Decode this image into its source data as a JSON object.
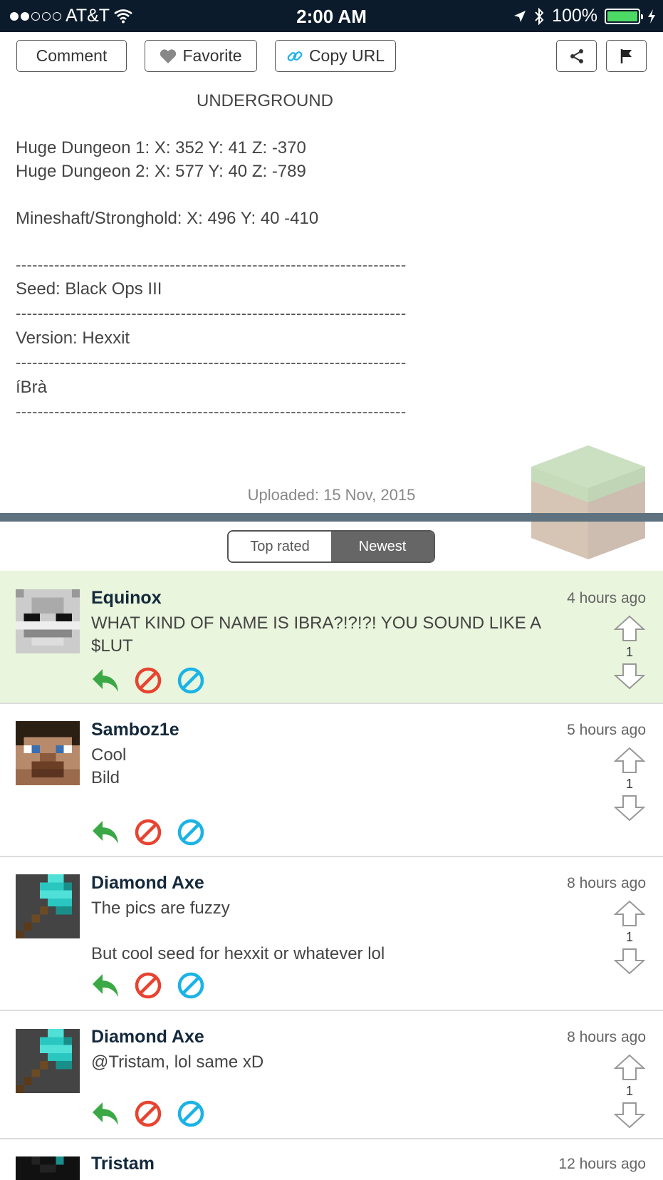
{
  "status_bar": {
    "carrier": "AT&T",
    "time": "2:00 AM",
    "battery": "100%"
  },
  "toolbar": {
    "comment_label": "Comment",
    "favorite_label": "Favorite",
    "copy_url_label": "Copy URL"
  },
  "description": {
    "heading": "UNDERGROUND",
    "lines": [
      "Huge Dungeon 1: X: 352 Y: 41 Z: -370",
      "Huge Dungeon 2: X: 577 Y: 40 Z: -789",
      "Mineshaft/Stronghold: X: 496 Y: 40 -410",
      "Seed: Black Ops III",
      "Version: Hexxit",
      "íBrà"
    ],
    "separator": "-----------------------------------------------------------------------"
  },
  "uploaded": "Uploaded: 15 Nov, 2015",
  "sort": {
    "options": [
      "Top rated",
      "Newest"
    ],
    "selected": "Newest"
  },
  "comments": [
    {
      "author": "Equinox",
      "time": "4 hours ago",
      "lines": [
        "WHAT KIND OF NAME IS IBRA?!?!?! YOU SOUND LIKE A",
        "$LUT"
      ],
      "votes": "1"
    },
    {
      "author": "Samboz1e",
      "time": "5 hours ago",
      "lines": [
        "Cool",
        "Bild"
      ],
      "votes": "1"
    },
    {
      "author": "Diamond Axe",
      "time": "8 hours ago",
      "lines": [
        "The pics are fuzzy",
        "",
        "But cool seed for hexxit or whatever lol"
      ],
      "votes": "1"
    },
    {
      "author": "Diamond Axe",
      "time": "8 hours ago",
      "lines": [
        "@Tristam, lol same xD"
      ],
      "votes": "1"
    },
    {
      "author": "Tristam",
      "time": "12 hours ago",
      "lines": [],
      "votes": ""
    }
  ],
  "colors": {
    "status_bar_bg": "#0b1b2b",
    "highlight_comment_bg": "#e9f5dc",
    "reply_green": "#3aa845",
    "report_red": "#e8432f",
    "block_blue": "#1ab3e6",
    "divider": "#5e7280"
  },
  "icons": {
    "reply": "reply-arrow-icon",
    "report": "report-icon",
    "block": "block-icon",
    "upvote": "arrow-up-icon",
    "downvote": "arrow-down-icon"
  }
}
